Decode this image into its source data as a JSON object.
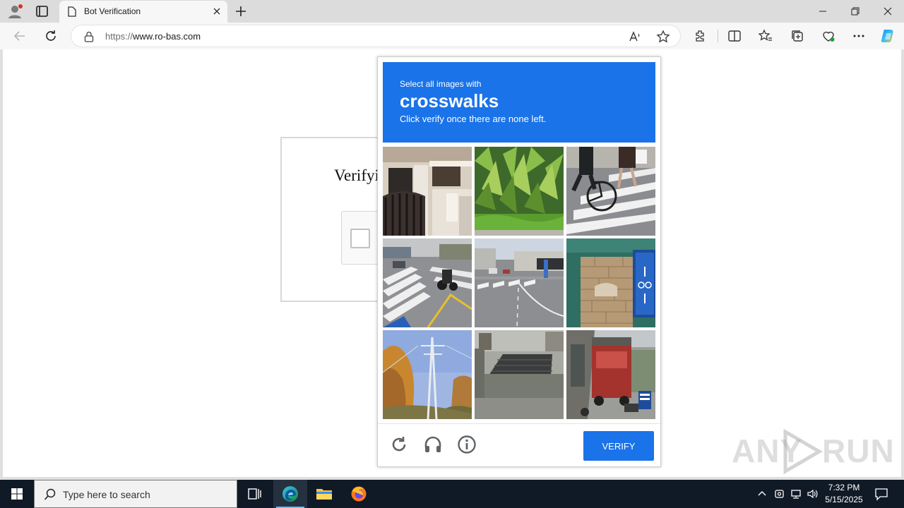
{
  "browser": {
    "tab_title": "Bot Verification",
    "url_prefix": "https://",
    "url_domain": "www.ro-bas.com"
  },
  "page": {
    "heading": "Verifyi"
  },
  "challenge": {
    "instruction": "Select all images with",
    "target": "crosswalks",
    "hint": "Click verify once there are none left.",
    "tiles": [
      "house-gate",
      "green-plants",
      "cyclist-on-crosswalk",
      "scooter-at-crosswalk",
      "street-with-crosswalk",
      "bicycle-sign-wall",
      "power-pylon-trees",
      "roof-and-wall",
      "red-truck-alley"
    ],
    "verify_label": "VERIFY",
    "header_color": "#1a73e8"
  },
  "watermark": {
    "text_left": "ANY",
    "text_right": "RUN"
  },
  "taskbar": {
    "search_placeholder": "Type here to search",
    "time": "7:32 PM",
    "date": "5/15/2025"
  }
}
